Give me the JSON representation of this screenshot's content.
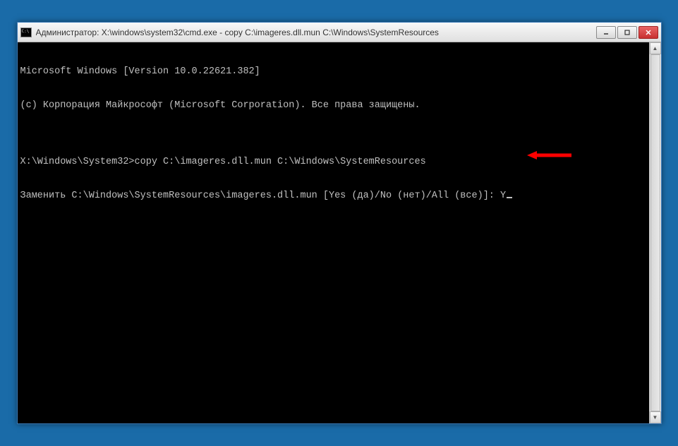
{
  "window": {
    "title": "Администратор: X:\\windows\\system32\\cmd.exe - copy  C:\\imageres.dll.mun C:\\Windows\\SystemResources"
  },
  "terminal": {
    "lines": [
      "Microsoft Windows [Version 10.0.22621.382]",
      "(c) Корпорация Майкрософт (Microsoft Corporation). Все права защищены.",
      "",
      "X:\\Windows\\System32>copy C:\\imageres.dll.mun C:\\Windows\\SystemResources",
      "Заменить C:\\Windows\\SystemResources\\imageres.dll.mun [Yes (да)/No (нет)/All (все)]: Y"
    ],
    "input_value": "Y"
  },
  "controls": {
    "minimize": "—",
    "maximize": "□",
    "close": "✕"
  }
}
